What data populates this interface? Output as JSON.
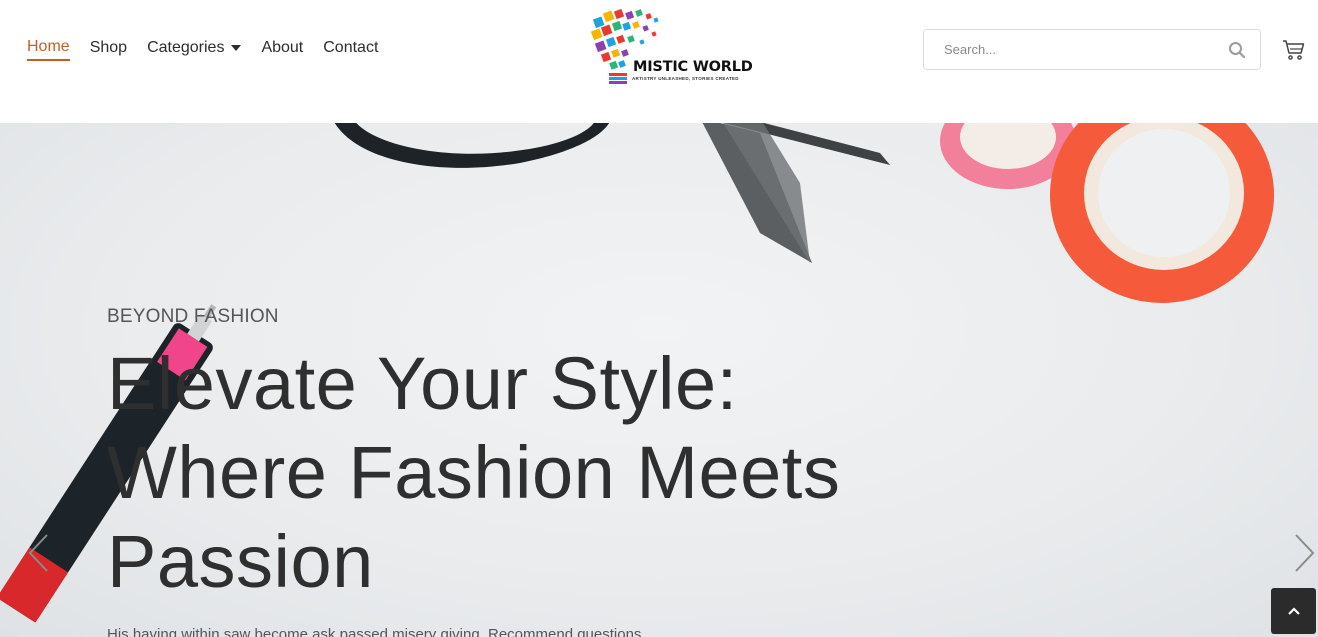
{
  "nav": {
    "items": [
      {
        "label": "Home",
        "active": true
      },
      {
        "label": "Shop"
      },
      {
        "label": "Categories",
        "has_dropdown": true
      },
      {
        "label": "About"
      },
      {
        "label": "Contact"
      }
    ]
  },
  "logo": {
    "name": "MISTIC WORLD",
    "tagline": "ARTISTRY UNLEASHED, STORIES CREATED"
  },
  "search": {
    "placeholder": "Search..."
  },
  "hero": {
    "subtitle": "BEYOND FASHION",
    "heading": "Elevate Your Style: Where Fashion Meets Passion",
    "description": "His having within saw become ask passed misery giving. Recommend questions"
  },
  "icons": {
    "search": "search-icon",
    "cart": "cart-icon",
    "prev": "chevron-left-icon",
    "next": "chevron-right-icon",
    "top": "chevron-up-icon"
  },
  "colors": {
    "accent": "#c4601f",
    "text": "#2f2f2f",
    "back_to_top": "#2b2b2b"
  }
}
